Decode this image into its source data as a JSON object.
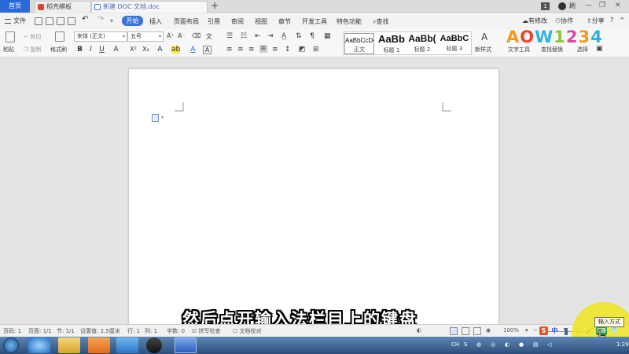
{
  "tabs": {
    "home": "首页",
    "items": [
      {
        "label": "稻壳模板",
        "icon_color": "#e0452c",
        "active": false
      },
      {
        "label": "新建 DOC 文档.doc",
        "icon_color": "#3a73d6",
        "active": true
      }
    ],
    "add": "+",
    "page_badge": "1",
    "user": "刷"
  },
  "menu": {
    "file": "文件",
    "items": [
      "开始",
      "插入",
      "页面布局",
      "引用",
      "审阅",
      "视图",
      "章节",
      "开发工具",
      "特色功能"
    ],
    "active_index": 0,
    "search": "查找",
    "right": [
      "有修改",
      "协作",
      "分享"
    ]
  },
  "ribbon": {
    "paste": "粘贴",
    "cut": "剪切",
    "copy": "复制",
    "format_painter": "格式刷",
    "font_name": "宋体 (正文)",
    "font_size": "五号",
    "styles": [
      {
        "sample": "AaBbCcDd",
        "name": "正文"
      },
      {
        "sample": "AaBb",
        "name": "标题 1"
      },
      {
        "sample": "AaBb(",
        "name": "标题 2"
      },
      {
        "sample": "AaBbC",
        "name": "标题 3"
      }
    ],
    "new_style": "新样式",
    "right_tools": [
      "文字工具",
      "查找替换",
      "选择"
    ]
  },
  "logo": {
    "parts": [
      "A",
      "O",
      "W",
      "1",
      "2",
      "3",
      "4"
    ]
  },
  "subtitle": "然后点开输入法栏目上的键盘",
  "status": {
    "page_no": "页码: 1",
    "pages": "页面: 1/1",
    "section": "节: 1/1",
    "setting": "设置值: 2.5厘米",
    "row": "行: 1",
    "col": "列: 1",
    "words": "字数: 0",
    "spell": "拼写检查",
    "proof": "文档校对",
    "zoom": "100%"
  },
  "tray": {
    "lang": "CH",
    "time": "1:29"
  },
  "ime": {
    "tooltip": "输入方式",
    "s_label": "S",
    "zh_label": "中"
  },
  "colors": {
    "accent": "#3b73d6",
    "highlight": "#f0e61e",
    "wps_red": "#e0452c"
  }
}
